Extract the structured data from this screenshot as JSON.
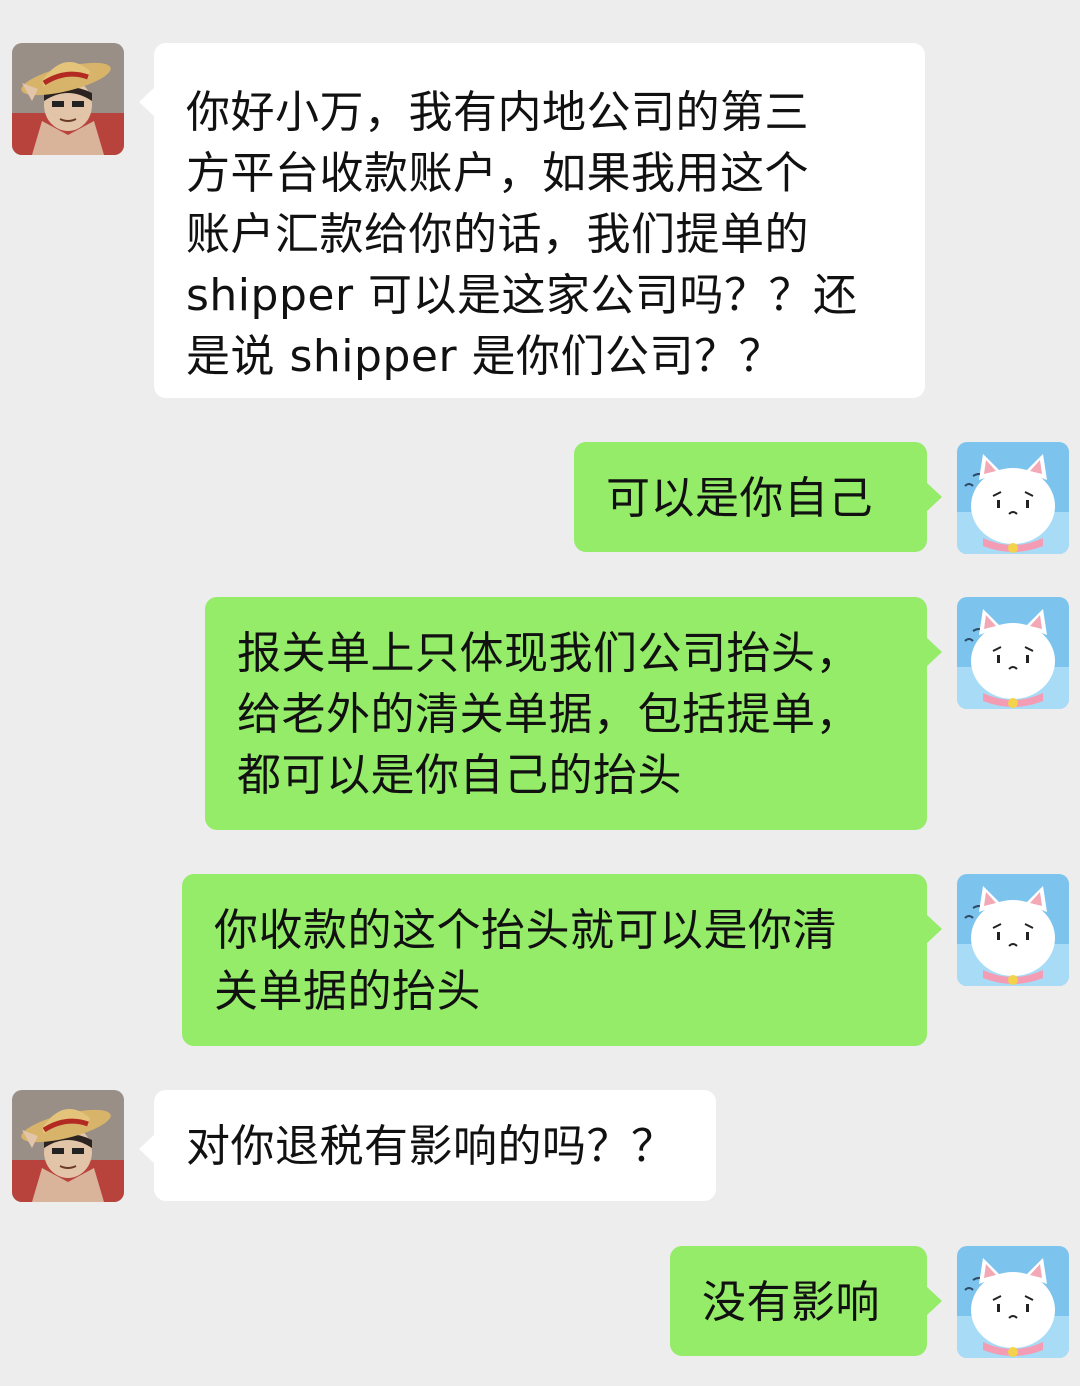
{
  "chat": {
    "messages": [
      {
        "sender": "other",
        "avatar_icon": "straw-hat-pirate-avatar-icon",
        "text": "你好小万，我有内地公司的第三\n方平台收款账户，如果我用这个\n账户汇款给你的话，我们提单的\nshipper 可以是这家公司吗？？还\n是说 shipper 是你们公司？？"
      },
      {
        "sender": "self",
        "avatar_icon": "white-cat-avatar-icon",
        "text": "可以是你自己"
      },
      {
        "sender": "self",
        "avatar_icon": "white-cat-avatar-icon",
        "text": "报关单上只体现我们公司抬头，\n给老外的清关单据，包括提单，\n都可以是你自己的抬头"
      },
      {
        "sender": "self",
        "avatar_icon": "white-cat-avatar-icon",
        "text": "你收款的这个抬头就可以是你清\n关单据的抬头"
      },
      {
        "sender": "other",
        "avatar_icon": "straw-hat-pirate-avatar-icon",
        "text": "对你退税有影响的吗？？"
      },
      {
        "sender": "self",
        "avatar_icon": "white-cat-avatar-icon",
        "text": "没有影响"
      }
    ]
  },
  "colors": {
    "background": "#ededed",
    "incoming_bubble": "#ffffff",
    "outgoing_bubble": "#95ec69"
  }
}
